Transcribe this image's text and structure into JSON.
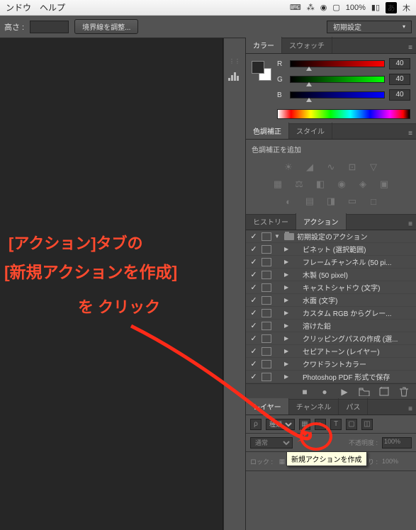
{
  "menubar": {
    "items": [
      "ンドウ",
      "ヘルプ"
    ],
    "battery": "100%",
    "ime": "あ",
    "day": "木"
  },
  "options_bar": {
    "height_label": "高さ :",
    "button_label": "境界線を調整...",
    "preset": "初期設定"
  },
  "color_panel": {
    "tabs": [
      "カラー",
      "スウォッチ"
    ],
    "channels": [
      {
        "name": "R",
        "value": "40"
      },
      {
        "name": "G",
        "value": "40"
      },
      {
        "name": "B",
        "value": "40"
      }
    ]
  },
  "adjustments_panel": {
    "tabs": [
      "色調補正",
      "スタイル"
    ],
    "add_label": "色調補正を追加"
  },
  "history_panel": {
    "tabs": [
      "ヒストリー",
      "アクション"
    ],
    "set_name": "初期設定のアクション",
    "actions": [
      "ビネット (選択範囲)",
      "フレームチャンネル (50 pi...",
      "木製 (50 pixel)",
      "キャストシャドウ (文字)",
      "水面 (文字)",
      "カスタム RGB からグレー...",
      "溶けた鉛",
      "クリッピングパスの作成 (選...",
      "セピアトーン (レイヤー)",
      "クワドラントカラー",
      "Photoshop PDF 形式で保存"
    ]
  },
  "layers_panel": {
    "tabs": [
      "レイヤー",
      "チャンネル",
      "パス"
    ],
    "kind_label": "種類",
    "blend_mode": "通常",
    "opacity_label": "不透明度 :",
    "opacity_value": "100%",
    "lock_label": "ロック :",
    "fill_label": "塗り :",
    "fill_value": "100%"
  },
  "tooltip": "新規アクションを作成",
  "annotations": {
    "line1": "[アクション]タブの",
    "line2": "[新規アクションを作成]",
    "line3": "を クリック"
  }
}
